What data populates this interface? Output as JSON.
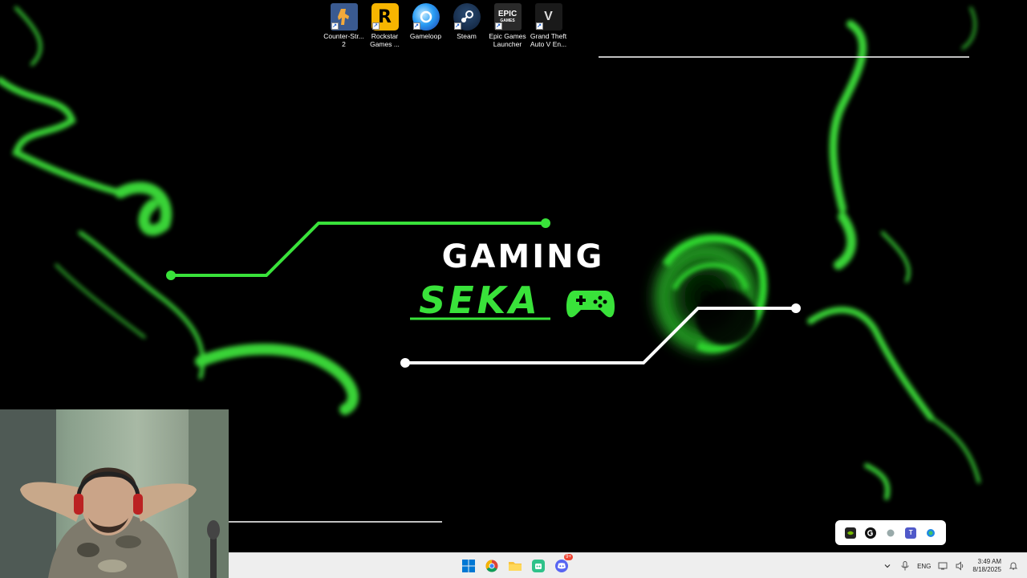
{
  "desktop": {
    "icons": [
      {
        "label": "Counter-Str...\n2",
        "icon": "counter-strike-icon"
      },
      {
        "label": "Rockstar\nGames ...",
        "icon": "rockstar-games-icon"
      },
      {
        "label": "Gameloop",
        "icon": "gameloop-icon"
      },
      {
        "label": "Steam",
        "icon": "steam-icon"
      },
      {
        "label": "Epic Games\nLauncher",
        "icon": "epic-games-icon"
      },
      {
        "label": "Grand Theft\nAuto V En...",
        "icon": "gta-v-icon"
      }
    ],
    "icon_glyphs": {
      "rockstar": "R",
      "epic_top": "EPIC",
      "epic_bottom": "GAMES",
      "gta": "V"
    }
  },
  "wallpaper": {
    "title_line1": "GAMING",
    "title_line2": "SEKA",
    "accent_color": "#39e23a",
    "title_color": "#ffffff"
  },
  "taskbar": {
    "pinned": [
      "windows-start-icon",
      "chrome-icon",
      "file-explorer-icon",
      "app-icon",
      "discord-icon"
    ],
    "discord_badge": "9+",
    "tray": {
      "language": "ENG",
      "time": "3:49 AM",
      "date": "8/18/2025"
    }
  },
  "tray_overflow": {
    "icons": [
      "nvidia-icon",
      "g-hub-icon",
      "status-dot-icon",
      "teams-icon",
      "network-app-icon"
    ]
  }
}
